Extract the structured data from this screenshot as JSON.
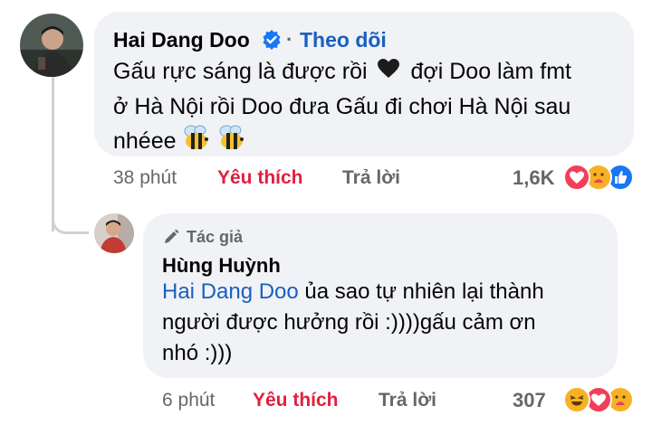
{
  "comment1": {
    "author": "Hai Dang Doo",
    "separator": "·",
    "follow_label": "Theo dõi",
    "text_line1": "Gấu rực sáng là được rồi",
    "text_line1b": "đợi Doo làm fmt",
    "text_line2": "ở Hà Nội rồi Doo đưa Gấu đi chơi Hà Nội sau",
    "text_line3": "nhéee",
    "time": "38 phút",
    "like_label": "Yêu thích",
    "reply_label": "Trả lời",
    "reaction_count": "1,6K",
    "reactions": [
      "heart-icon",
      "care-icon",
      "like-icon"
    ]
  },
  "comment2": {
    "author_badge": "Tác giả",
    "author": "Hùng Huỳnh",
    "mention": "Hai Dang Doo",
    "text_line1": " ủa sao tự nhiên lại thành",
    "text_line2": "người được hưởng rồi :))))gấu cảm ơn",
    "text_line3": "nhó :)))",
    "time": "6 phút",
    "like_label": "Yêu thích",
    "reply_label": "Trả lời",
    "reaction_count": "307",
    "reactions": [
      "haha-icon",
      "heart-icon",
      "care-icon"
    ]
  },
  "colors": {
    "bubble": "#f0f2f5",
    "link_blue": "#1a5fbf",
    "like_red": "#e41e3f",
    "meta_gray": "#65676b",
    "verified_blue": "#1877f2"
  }
}
